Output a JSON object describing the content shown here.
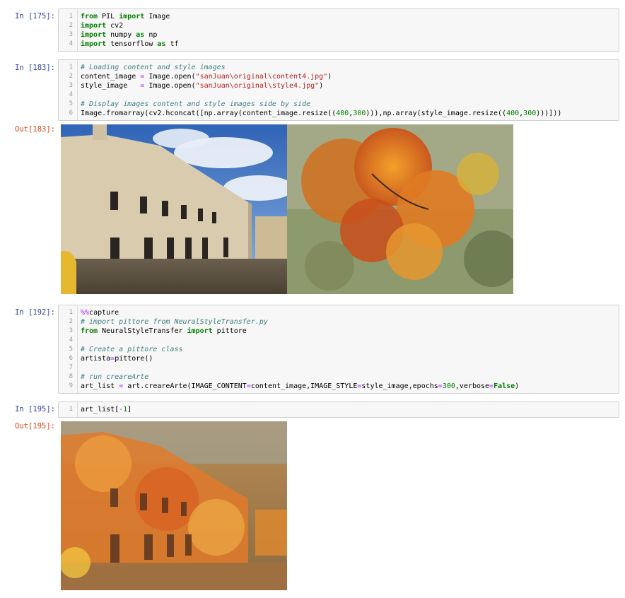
{
  "cells": [
    {
      "prompt": "In [175]:",
      "lines": [
        {
          "n": "1",
          "tokens": [
            [
              "kw",
              "from"
            ],
            [
              "",
              " PIL "
            ],
            [
              "kw",
              "import"
            ],
            [
              "",
              " Image"
            ]
          ]
        },
        {
          "n": "2",
          "tokens": [
            [
              "kw",
              "import"
            ],
            [
              "",
              " cv2"
            ]
          ]
        },
        {
          "n": "3",
          "tokens": [
            [
              "kw",
              "import"
            ],
            [
              "",
              " numpy "
            ],
            [
              "kw",
              "as"
            ],
            [
              "",
              " np"
            ]
          ]
        },
        {
          "n": "4",
          "tokens": [
            [
              "kw",
              "import"
            ],
            [
              "",
              " tensorflow "
            ],
            [
              "kw",
              "as"
            ],
            [
              "",
              " tf"
            ]
          ]
        }
      ]
    },
    {
      "prompt": "In [183]:",
      "lines": [
        {
          "n": "1",
          "tokens": [
            [
              "cm",
              "# Loading content and style images"
            ]
          ]
        },
        {
          "n": "2",
          "tokens": [
            [
              "",
              "content_image "
            ],
            [
              "op",
              "="
            ],
            [
              "",
              " Image.open("
            ],
            [
              "str",
              "\"sanJuan\\original\\content4.jpg\""
            ],
            [
              "",
              ")"
            ]
          ]
        },
        {
          "n": "3",
          "tokens": [
            [
              "",
              "style_image   "
            ],
            [
              "op",
              "="
            ],
            [
              "",
              " Image.open("
            ],
            [
              "str",
              "\"sanJuan\\original\\style4.jpg\""
            ],
            [
              "",
              ")"
            ]
          ]
        },
        {
          "n": "4",
          "tokens": []
        },
        {
          "n": "5",
          "tokens": [
            [
              "cm",
              "# Display images content and style images side by side"
            ]
          ]
        },
        {
          "n": "6",
          "tokens": [
            [
              "",
              "Image.fromarray(cv2.hconcat([np.array(content_image.resize(("
            ],
            [
              "num",
              "400"
            ],
            [
              "",
              ","
            ],
            [
              "num",
              "300"
            ],
            [
              "",
              "))),np.array(style_image.resize(("
            ],
            [
              "num",
              "400"
            ],
            [
              "",
              ","
            ],
            [
              "num",
              "300"
            ],
            [
              "",
              ")))]))"
            ]
          ]
        }
      ]
    },
    {
      "prompt": "In [192]:",
      "lines": [
        {
          "n": "1",
          "tokens": [
            [
              "mg",
              "%%"
            ],
            [
              "",
              "capture"
            ]
          ]
        },
        {
          "n": "2",
          "tokens": [
            [
              "cm",
              "# import pittore from NeuralStyleTransfer.py"
            ]
          ]
        },
        {
          "n": "3",
          "tokens": [
            [
              "kw",
              "from"
            ],
            [
              "",
              " NeuralStyleTransfer "
            ],
            [
              "kw",
              "import"
            ],
            [
              "",
              " pittore"
            ]
          ]
        },
        {
          "n": "4",
          "tokens": []
        },
        {
          "n": "5",
          "tokens": [
            [
              "cm",
              "# Create a pittore class"
            ]
          ]
        },
        {
          "n": "6",
          "tokens": [
            [
              "",
              "artista"
            ],
            [
              "op",
              "="
            ],
            [
              "",
              "pittore()"
            ]
          ]
        },
        {
          "n": "7",
          "tokens": []
        },
        {
          "n": "8",
          "tokens": [
            [
              "cm",
              "# run creareArte"
            ]
          ]
        },
        {
          "n": "9",
          "tokens": [
            [
              "",
              "art_list "
            ],
            [
              "op",
              "="
            ],
            [
              "",
              " art.creareArte(IMAGE_CONTENT"
            ],
            [
              "op",
              "="
            ],
            [
              "",
              "content_image,IMAGE_STYLE"
            ],
            [
              "op",
              "="
            ],
            [
              "",
              "style_image,epochs"
            ],
            [
              "op",
              "="
            ],
            [
              "num",
              "300"
            ],
            [
              "",
              ",verbose"
            ],
            [
              "op",
              "="
            ],
            [
              "kw",
              "False"
            ],
            [
              "",
              ")"
            ]
          ]
        }
      ]
    },
    {
      "prompt": "In [195]:",
      "lines": [
        {
          "n": "1",
          "tokens": [
            [
              "",
              "art_list["
            ],
            [
              "op",
              "-"
            ],
            [
              "num",
              "1"
            ],
            [
              "",
              "]"
            ]
          ]
        }
      ]
    }
  ],
  "outputs": [
    {
      "prompt": "Out[183]:",
      "image": "content-and-style-image"
    },
    {
      "prompt": "Out[195]:",
      "image": "stylized-output-image"
    }
  ]
}
